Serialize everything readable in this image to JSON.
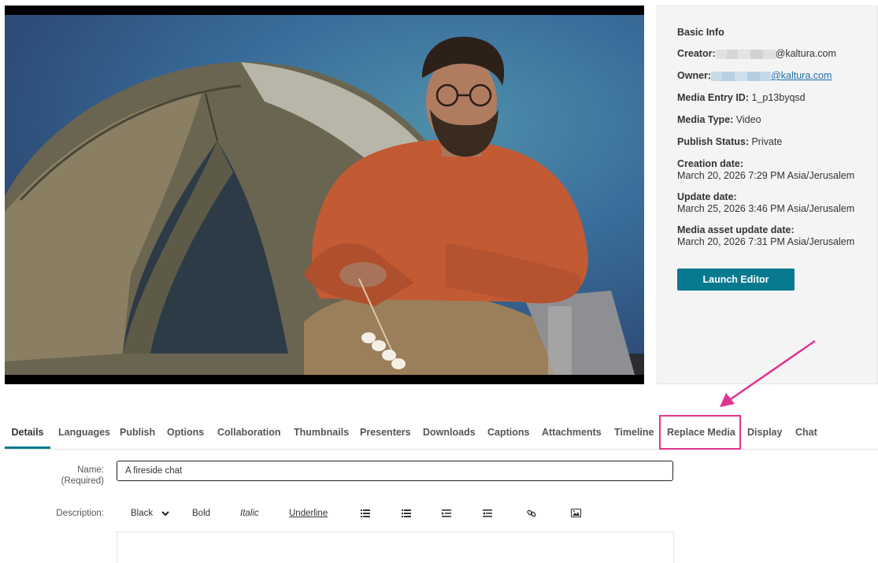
{
  "info": {
    "heading": "Basic Info",
    "creator_label": "Creator:",
    "creator_domain": "@kaltura.com",
    "owner_label": "Owner:",
    "owner_domain": "@kaltura.com",
    "entry_id_label": "Media Entry ID:",
    "entry_id_value": "1_p13byqsd",
    "media_type_label": "Media Type:",
    "media_type_value": "Video",
    "publish_status_label": "Publish Status:",
    "publish_status_value": "Private",
    "creation_label": "Creation date:",
    "creation_value": "March 20, 2026 7:29 PM Asia/Jerusalem",
    "update_label": "Update date:",
    "update_value": "March 25, 2026 3:46 PM Asia/Jerusalem",
    "asset_update_label": "Media asset update date:",
    "asset_update_value": "March 20, 2026 7:31 PM Asia/Jerusalem",
    "launch_editor_label": "Launch Editor"
  },
  "tabs": [
    {
      "label": "Details",
      "active": true
    },
    {
      "label": "Languages"
    },
    {
      "label": "Publish"
    },
    {
      "label": "Options"
    },
    {
      "label": "Collaboration"
    },
    {
      "label": "Thumbnails"
    },
    {
      "label": "Presenters"
    },
    {
      "label": "Downloads"
    },
    {
      "label": "Captions"
    },
    {
      "label": "Attachments"
    },
    {
      "label": "Timeline"
    },
    {
      "label": "Replace Media"
    },
    {
      "label": "Display"
    },
    {
      "label": "Chat"
    }
  ],
  "form": {
    "name_label": "Name:",
    "name_required": "(Required)",
    "name_value": "A fireside chat",
    "description_label": "Description:",
    "toolbar": {
      "color_value": "Black",
      "bold": "Bold",
      "italic": "Italic",
      "underline": "Underline"
    }
  },
  "colors": {
    "accent": "#087a8f",
    "annotation": "#e0338e",
    "link": "#1b6fa8"
  }
}
